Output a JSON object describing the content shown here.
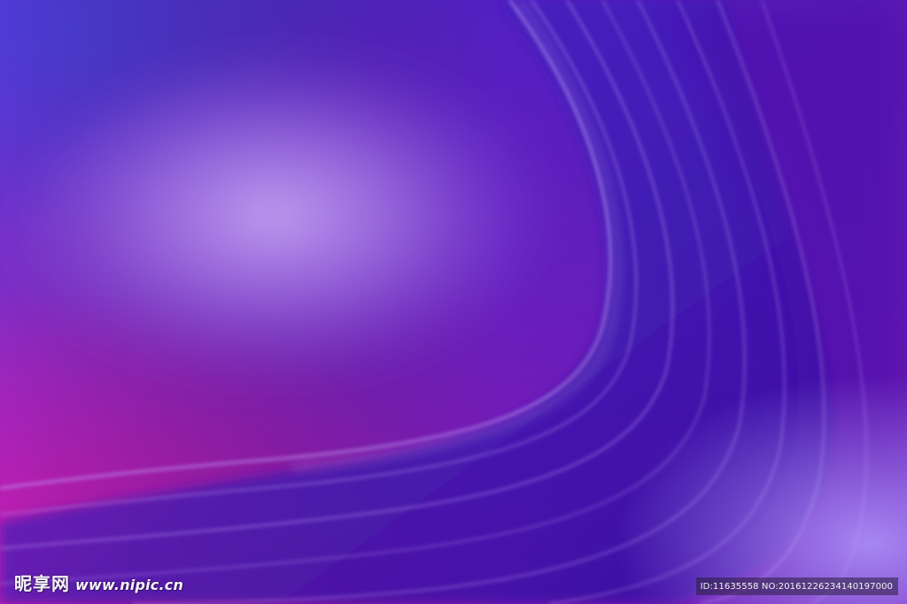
{
  "image": {
    "subject": "abstract purple and violet gradient background with flowing curved light streaks",
    "colors": {
      "deep_blue_violet": "#4a1bb8",
      "light_lavender_glow": "#a57ae6",
      "magenta": "#b01fb0",
      "deep_purple": "#5a0fa8",
      "streak_highlight": "#c7a8ff"
    }
  },
  "watermark": {
    "brand": "昵享网",
    "site": "www.nipic.cn",
    "id_text": "ID:11635558 NO:20161226234140197000"
  }
}
